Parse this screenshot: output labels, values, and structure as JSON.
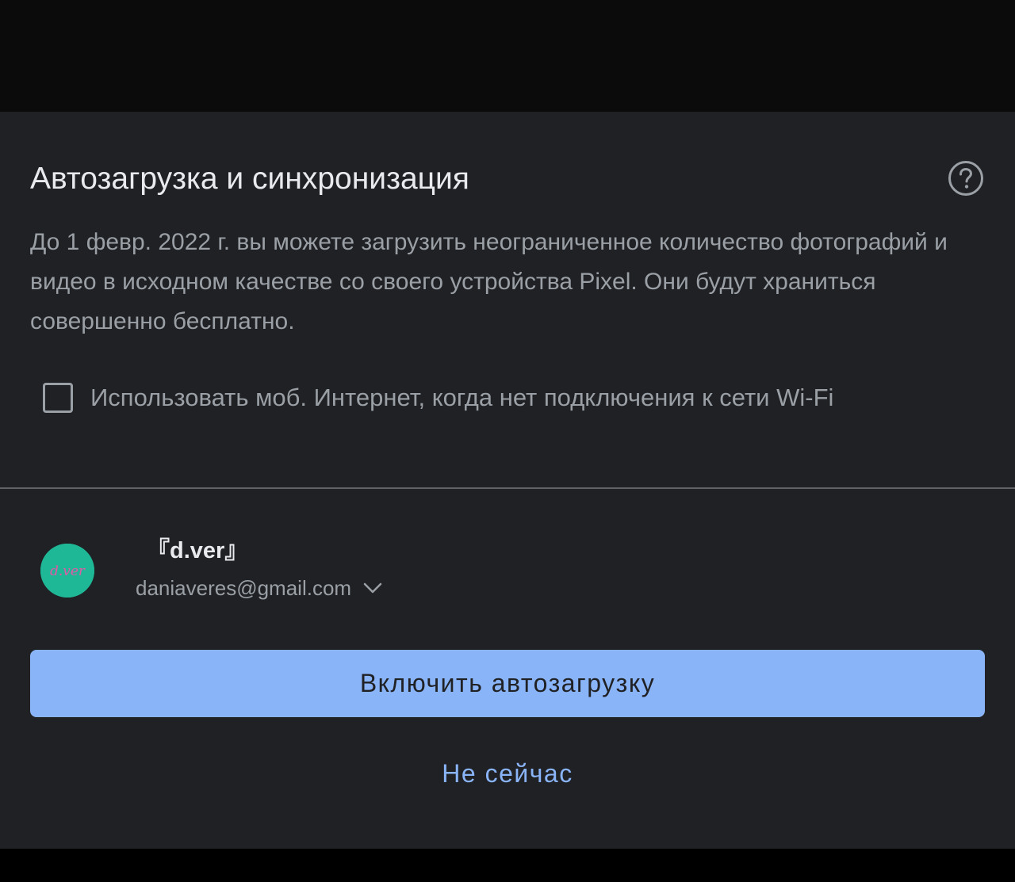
{
  "dialog": {
    "title": "Автозагрузка и синхронизация",
    "help_icon": "help-circle-icon",
    "description": "До 1 февр. 2022 г. вы можете загрузить неограниченное количество фотографий и видео в исходном качестве со своего устройства Pixel. Они будут храниться совершенно бесплатно.",
    "mobile_data_checkbox": {
      "label": "Использовать моб. Интернет, когда нет подключения к сети Wi-Fi",
      "checked": false
    }
  },
  "account": {
    "name": "『d.ver』",
    "email": "daniaveres@gmail.com",
    "avatar_text": "d.ver",
    "avatar_color": "#1fb897",
    "dropdown_icon": "chevron-down-icon"
  },
  "actions": {
    "primary_label": "Включить автозагрузку",
    "secondary_label": "Не сейчас"
  },
  "colors": {
    "background": "#202124",
    "accent": "#8ab4f8",
    "text_primary": "#e8eaed",
    "text_secondary": "#9aa0a6"
  }
}
